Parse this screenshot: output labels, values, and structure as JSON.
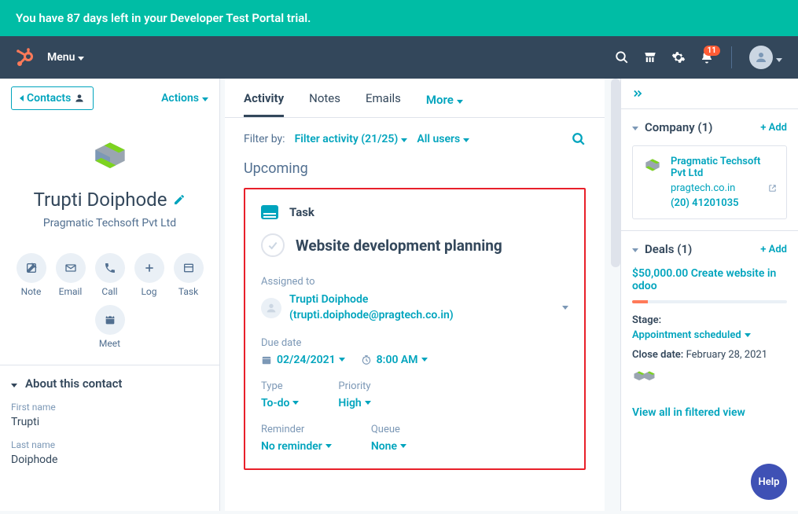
{
  "trial_banner": "You have 87 days left in your Developer Test Portal trial.",
  "top": {
    "menu": "Menu",
    "notif_count": "11"
  },
  "left": {
    "contacts": "Contacts",
    "actions": "Actions",
    "name": "Trupti Doiphode",
    "company": "Pragmatic Techsoft Pvt Ltd",
    "actions_grid": {
      "note": "Note",
      "email": "Email",
      "call": "Call",
      "log": "Log",
      "task": "Task",
      "meet": "Meet"
    },
    "about": "About this contact",
    "first_label": "First name",
    "first_value": "Trupti",
    "last_label": "Last name",
    "last_value": "Doiphode"
  },
  "center": {
    "tabs": {
      "activity": "Activity",
      "notes": "Notes",
      "emails": "Emails",
      "more": "More"
    },
    "filter_by": "Filter by:",
    "filter_activity": "Filter activity (21/25)",
    "all_users": "All users",
    "upcoming": "Upcoming",
    "task": {
      "label": "Task",
      "title": "Website development planning",
      "assigned_label": "Assigned to",
      "assignee_name": "Trupti Doiphode",
      "assignee_email": "(trupti.doiphode@pragtech.co.in)",
      "due_label": "Due date",
      "due_date": "02/24/2021",
      "due_time": "8:00 AM",
      "type_label": "Type",
      "type_value": "To-do",
      "priority_label": "Priority",
      "priority_value": "High",
      "reminder_label": "Reminder",
      "reminder_value": "No reminder",
      "queue_label": "Queue",
      "queue_value": "None"
    }
  },
  "right": {
    "company_header": "Company (1)",
    "add": "+ Add",
    "company_name": "Pragmatic Techsoft Pvt Ltd",
    "company_site": "pragtech.co.in",
    "company_phone": "(20) 41201035",
    "deals_header": "Deals (1)",
    "deal_title": "$50,000.00 Create website in odoo",
    "stage_label": "Stage:",
    "stage_value": "Appointment scheduled",
    "close_label": "Close date:",
    "close_value": "February 28, 2021",
    "view_all": "View all in filtered view",
    "help": "Help"
  }
}
